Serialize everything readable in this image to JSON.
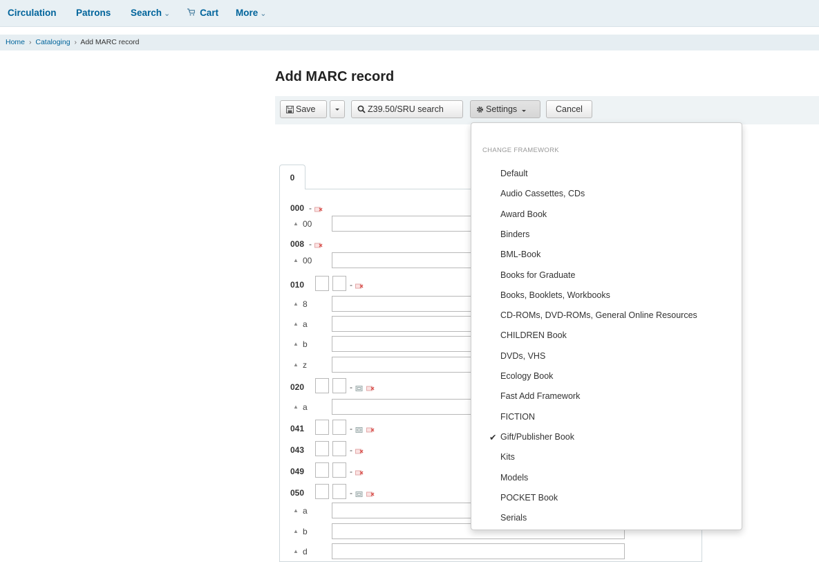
{
  "nav": {
    "items": [
      {
        "label": "Circulation",
        "caret": ""
      },
      {
        "label": "Patrons",
        "caret": ""
      },
      {
        "label": "Search",
        "caret": "⌄"
      },
      {
        "label": "Cart",
        "caret": ""
      },
      {
        "label": "More",
        "caret": "⌄"
      }
    ],
    "cart_icon": "cart-icon"
  },
  "breadcrumbs": {
    "home": "Home",
    "sep": "›",
    "cataloging": "Cataloging",
    "current": "Add MARC record"
  },
  "page": {
    "title": "Add MARC record"
  },
  "toolbar": {
    "save": "Save",
    "z3950": "Z39.50/SRU search",
    "settings": "Settings",
    "cancel": "Cancel"
  },
  "editor": {
    "tab": "0",
    "dash": "-",
    "tags": [
      {
        "tag": "000",
        "indicators": false,
        "copy": false
      },
      {
        "tag": "008",
        "indicators": false,
        "copy": false
      },
      {
        "tag": "010",
        "indicators": true,
        "copy": false
      },
      {
        "tag": "020",
        "indicators": true,
        "copy": true
      },
      {
        "tag": "041",
        "indicators": true,
        "copy": true
      },
      {
        "tag": "043",
        "indicators": true,
        "copy": false
      },
      {
        "tag": "049",
        "indicators": true,
        "copy": false
      },
      {
        "tag": "050",
        "indicators": true,
        "copy": true
      }
    ],
    "subfields": [
      {
        "code": "00"
      },
      {
        "code": "00"
      },
      {
        "code": "8"
      },
      {
        "code": "a"
      },
      {
        "code": "b"
      },
      {
        "code": "z"
      },
      {
        "code": "a"
      },
      {
        "code": "a"
      },
      {
        "code": "b"
      },
      {
        "code": "d"
      }
    ]
  },
  "settings_menu": {
    "header": "CHANGE FRAMEWORK",
    "check": "✔",
    "selected": "Gift/Publisher Book",
    "items": [
      "Default",
      "Audio Cassettes, CDs",
      "Award Book",
      "Binders",
      "BML-Book",
      "Books for Graduate",
      "Books, Booklets, Workbooks",
      "CD-ROMs, DVD-ROMs, General Online Resources",
      "CHILDREN Book",
      "DVDs, VHS",
      "Ecology Book",
      "Fast Add Framework",
      "FICTION",
      "Gift/Publisher Book",
      "Kits",
      "Models",
      "POCKET Book",
      "Serials"
    ]
  },
  "colors": {
    "link": "#00649b",
    "nav_bg": "#e8f0f4",
    "delete_icon": "#d9534f"
  }
}
